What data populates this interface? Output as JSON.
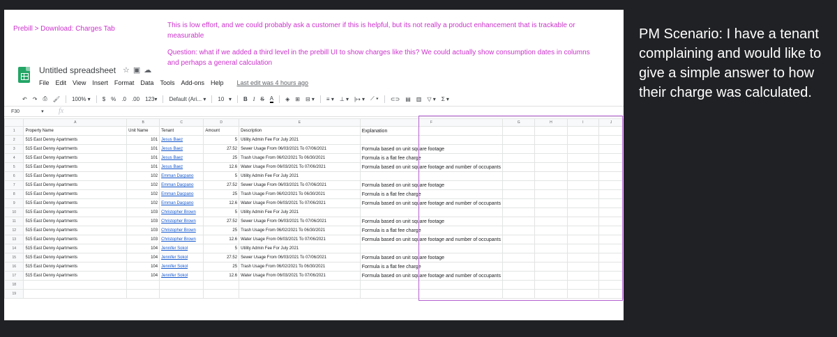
{
  "notes": {
    "breadcrumb": "Prebill > Download: Charges Tab",
    "note1": "This is low effort, and we could probably ask a customer if this is helpful, but its not really a product enhancement that is trackable or measurable",
    "note2": "Question: what if we added a third level in the prebill UI to show charges like this? We could actually show consumption dates in columns and perhaps a general calculation"
  },
  "pm_scenario": "PM Scenario: I have a tenant complaining and would like to give a simple answer to how their charge was calculated.",
  "spreadsheet": {
    "title": "Untitled spreadsheet",
    "menu": [
      "File",
      "Edit",
      "View",
      "Insert",
      "Format",
      "Data",
      "Tools",
      "Add-ons",
      "Help"
    ],
    "last_edit": "Last edit was 4 hours ago",
    "toolbar": {
      "zoom": "100%",
      "currency": "$",
      "percent": "%",
      "dec_less": ".0",
      "dec_more": ".00",
      "format_more": "123",
      "font": "Default (Ari...",
      "font_size": "10",
      "bold": "B",
      "italic": "I",
      "strike": "S",
      "text_color": "A"
    },
    "cell_ref": "F30",
    "fx": "fx",
    "col_letters": [
      "",
      "A",
      "B",
      "C",
      "D",
      "E",
      "F",
      "G",
      "H",
      "I",
      "J"
    ],
    "header_row": [
      "1",
      "Property Name",
      "Unit Name",
      "Tenant",
      "Amount",
      "Description",
      "Explanation"
    ],
    "rows": [
      {
        "n": "2",
        "property": "515 East Denny Apartments",
        "unit": "101",
        "tenant": "Jesus Baez",
        "amount": "5",
        "desc": "Utility Admin Fee For July 2021",
        "expl": ""
      },
      {
        "n": "3",
        "property": "515 East Denny Apartments",
        "unit": "101",
        "tenant": "Jesus Baez",
        "amount": "27.52",
        "desc": "Sewer Usage From 06/03/2021 To 07/06/2021",
        "expl": "Formula based on unit square footage"
      },
      {
        "n": "4",
        "property": "515 East Denny Apartments",
        "unit": "101",
        "tenant": "Jesus Baez",
        "amount": "25",
        "desc": "Trash Usage From 06/02/2021 To 06/30/2021",
        "expl": "Formula is a flat fee charge"
      },
      {
        "n": "5",
        "property": "515 East Denny Apartments",
        "unit": "101",
        "tenant": "Jesus Baez",
        "amount": "12.6",
        "desc": "Water Usage From 06/03/2021 To 07/06/2021",
        "expl": "Formula based on unit square footage and number of occupants"
      },
      {
        "n": "6",
        "property": "515 East Denny Apartments",
        "unit": "102",
        "tenant": "Emman Dacpano",
        "amount": "5",
        "desc": "Utility Admin Fee For July 2021",
        "expl": ""
      },
      {
        "n": "7",
        "property": "515 East Denny Apartments",
        "unit": "102",
        "tenant": "Emman Dacpano",
        "amount": "27.52",
        "desc": "Sewer Usage From 06/03/2021 To 07/06/2021",
        "expl": "Formula based on unit square footage"
      },
      {
        "n": "8",
        "property": "515 East Denny Apartments",
        "unit": "102",
        "tenant": "Emman Dacpano",
        "amount": "25",
        "desc": "Trash Usage From 06/02/2021 To 06/30/2021",
        "expl": "Formula is a flat fee charge"
      },
      {
        "n": "9",
        "property": "515 East Denny Apartments",
        "unit": "102",
        "tenant": "Emman Dacpano",
        "amount": "12.6",
        "desc": "Water Usage From 06/03/2021 To 07/06/2021",
        "expl": "Formula based on unit square footage and number of occupants"
      },
      {
        "n": "10",
        "property": "515 East Denny Apartments",
        "unit": "103",
        "tenant": "Christopher Brown",
        "amount": "5",
        "desc": "Utility Admin Fee For July 2021",
        "expl": ""
      },
      {
        "n": "11",
        "property": "515 East Denny Apartments",
        "unit": "103",
        "tenant": "Christopher Brown",
        "amount": "27.52",
        "desc": "Sewer Usage From 06/03/2021 To 07/06/2021",
        "expl": "Formula based on unit square footage"
      },
      {
        "n": "12",
        "property": "515 East Denny Apartments",
        "unit": "103",
        "tenant": "Christopher Brown",
        "amount": "25",
        "desc": "Trash Usage From 06/02/2021 To 06/30/2021",
        "expl": "Formula is a flat fee charge"
      },
      {
        "n": "13",
        "property": "515 East Denny Apartments",
        "unit": "103",
        "tenant": "Christopher Brown",
        "amount": "12.6",
        "desc": "Water Usage From 06/03/2021 To 07/06/2021",
        "expl": "Formula based on unit square footage and number of occupants"
      },
      {
        "n": "14",
        "property": "515 East Denny Apartments",
        "unit": "104",
        "tenant": "Jennifer Sokol",
        "amount": "5",
        "desc": "Utility Admin Fee For July 2021",
        "expl": ""
      },
      {
        "n": "15",
        "property": "515 East Denny Apartments",
        "unit": "104",
        "tenant": "Jennifer Sokol",
        "amount": "27.52",
        "desc": "Sewer Usage From 06/03/2021 To 07/06/2021",
        "expl": "Formula based on unit square footage"
      },
      {
        "n": "16",
        "property": "515 East Denny Apartments",
        "unit": "104",
        "tenant": "Jennifer Sokol",
        "amount": "25",
        "desc": "Trash Usage From 06/02/2021 To 06/30/2021",
        "expl": "Formula is a flat fee charge"
      },
      {
        "n": "17",
        "property": "515 East Denny Apartments",
        "unit": "104",
        "tenant": "Jennifer Sokol",
        "amount": "12.6",
        "desc": "Water Usage From 06/03/2021 To 07/06/2021",
        "expl": "Formula based on unit square footage and number of occupants"
      }
    ],
    "empty_rows": [
      "18",
      "19"
    ]
  },
  "colors": {
    "annotation": "#cc33cc",
    "highlight": "#b35fd1",
    "link": "#1155cc",
    "sheets_green": "#23a566",
    "background": "#202124"
  }
}
